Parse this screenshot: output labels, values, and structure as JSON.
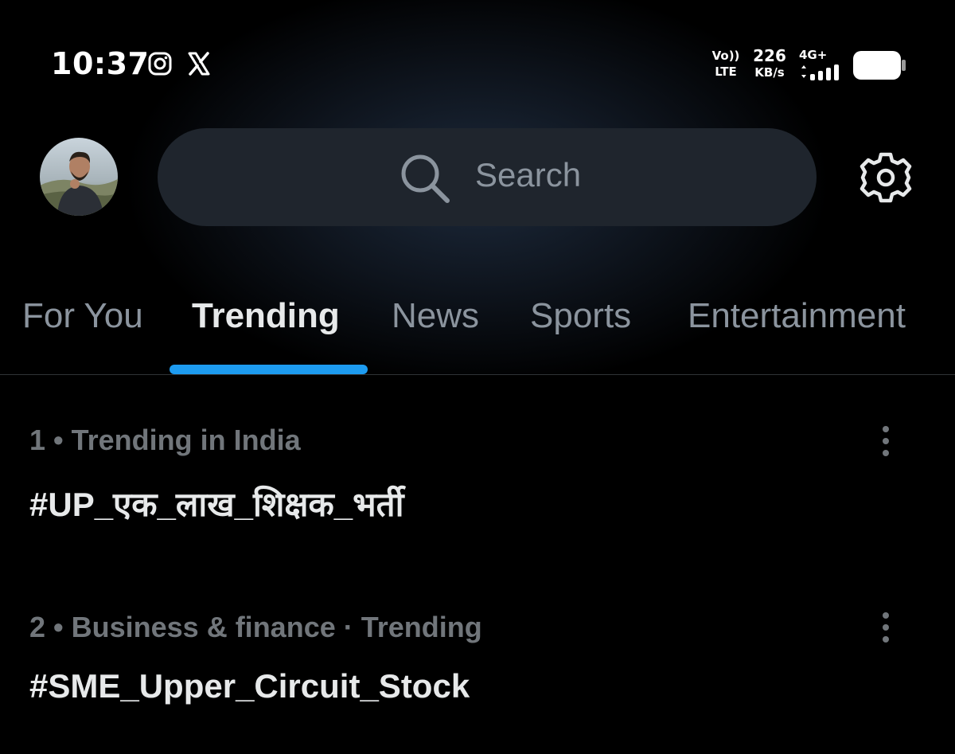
{
  "status_bar": {
    "time": "10:37",
    "notification_icons": [
      "instagram-icon",
      "x-icon"
    ],
    "volte_line1": "Vo))",
    "volte_line2": "LTE",
    "speed_value": "226",
    "speed_unit": "KB/s",
    "network_type": "4G+",
    "battery_level": 0.9
  },
  "header": {
    "search_placeholder": "Search"
  },
  "tabs": [
    {
      "label": "For You",
      "active": false
    },
    {
      "label": "Trending",
      "active": true
    },
    {
      "label": "News",
      "active": false
    },
    {
      "label": "Sports",
      "active": false
    },
    {
      "label": "Entertainment",
      "active": false
    }
  ],
  "trends": [
    {
      "meta": "1 • Trending in India",
      "title": "#UP_एक_लाख_शिक्षक_भर्ती"
    },
    {
      "meta": "2 • Business & finance · Trending",
      "title": "#SME_Upper_Circuit_Stock"
    }
  ],
  "colors": {
    "accent": "#1d9bf0",
    "background": "#000000",
    "secondary_text": "#71767b",
    "primary_text": "#e7e9ea"
  }
}
